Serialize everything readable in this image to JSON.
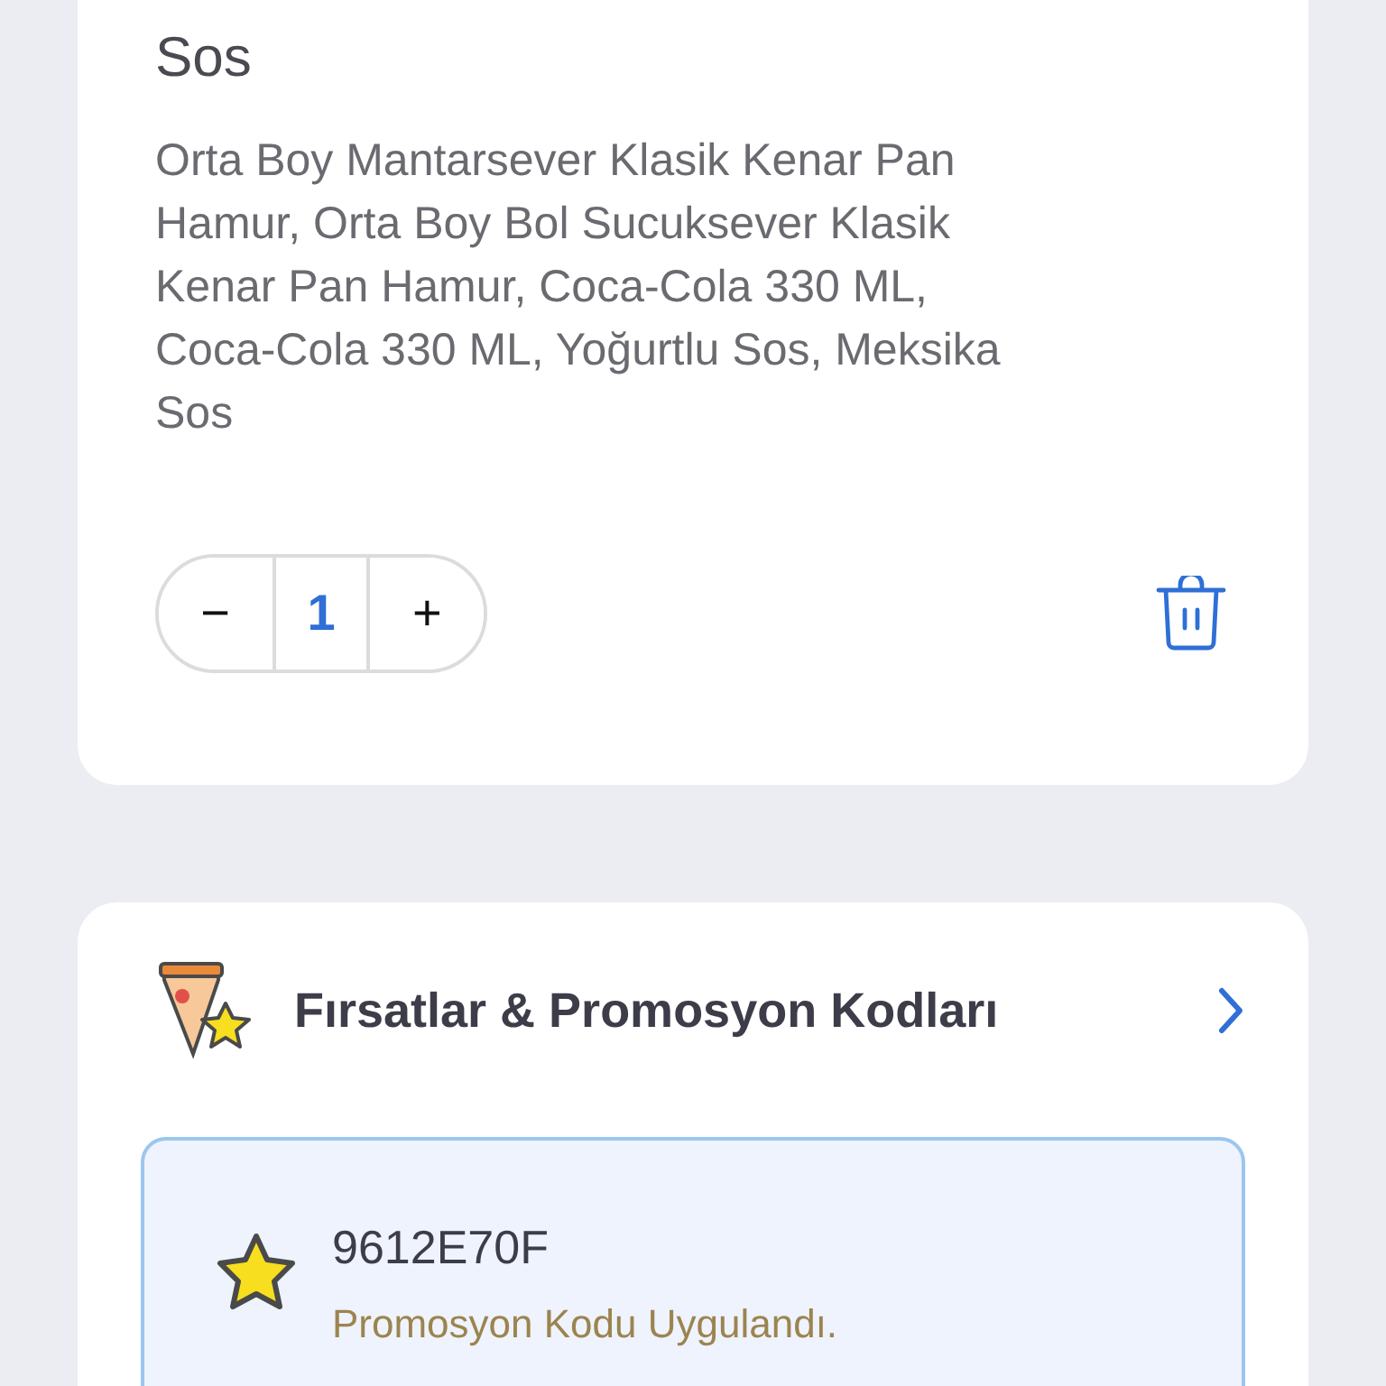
{
  "product": {
    "title": "Sos",
    "description": "Orta Boy Mantarsever Klasik Kenar Pan Hamur, Orta Boy Bol Sucuksever Klasik Kenar Pan Hamur, Coca-Cola 330 ML, Coca-Cola 330 ML, Yoğurtlu Sos, Meksika Sos",
    "stepper": {
      "minus": "−",
      "quantity": "1",
      "plus": "+"
    }
  },
  "promotions": {
    "title": "Fırsatlar & Promosyon Kodları",
    "applied": {
      "code": "9612E70F",
      "message": "Promosyon Kodu Uygulandı."
    }
  }
}
